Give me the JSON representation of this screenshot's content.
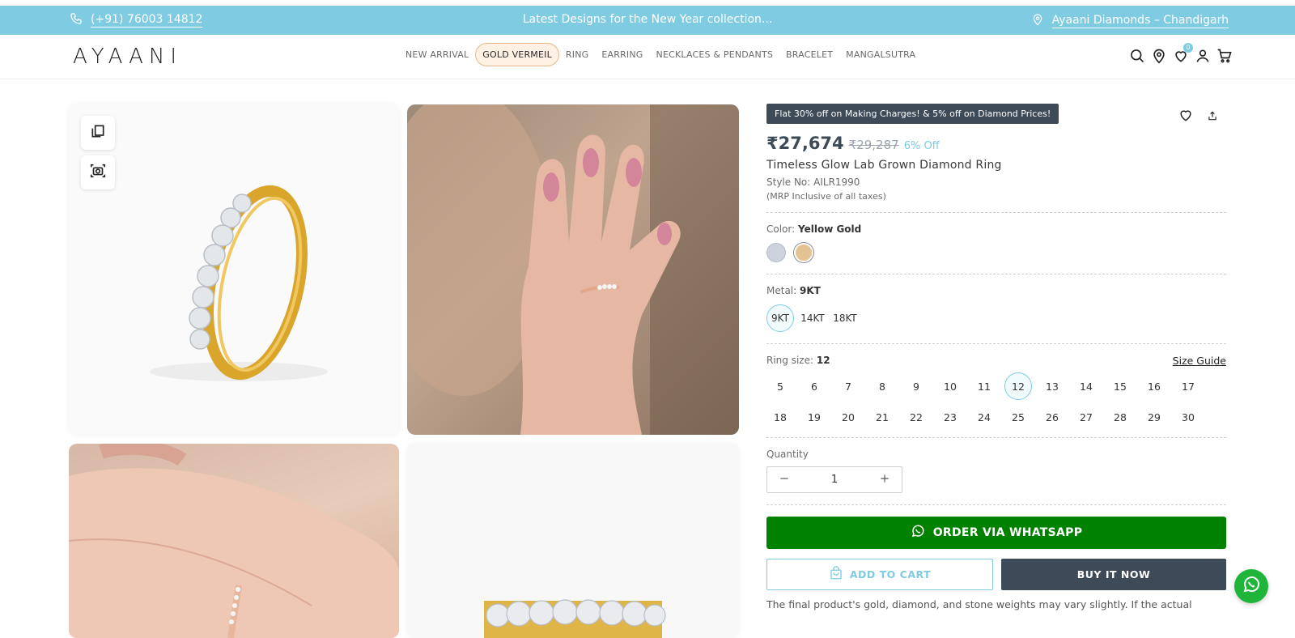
{
  "announcement": {
    "phone": "(+91) 76003 14812",
    "message": "Latest Designs for the New Year collection...",
    "store": "Ayaani Diamonds – Chandigarh"
  },
  "header": {
    "logo": "AYAANI",
    "nav": [
      "NEW ARRIVAL",
      "GOLD VERMEIL",
      "RING",
      "EARRING",
      "NECKLACES & PENDANTS",
      "BRACELET",
      "MANGALSUTRA"
    ],
    "active_nav": "GOLD VERMEIL",
    "wishlist_count": "0",
    "icons": [
      "search-icon",
      "store-location-icon",
      "wishlist-heart-icon",
      "account-user-icon",
      "cart-icon"
    ]
  },
  "product": {
    "promo": "Flat 30% off on Making Charges! & 5% off on Diamond Prices!",
    "price": "₹27,674",
    "mrp": "₹29,287",
    "discount": "6% Off",
    "title": "Timeless Glow Lab Grown Diamond Ring",
    "style_no": "Style No: AILR1990",
    "tax_note": "(MRP Inclusive of all taxes)",
    "color_label": "Color:",
    "color_value": "Yellow Gold",
    "colors": [
      {
        "name": "White Gold",
        "hex": "#cdd2dc"
      },
      {
        "name": "Yellow Gold",
        "hex": "#e5c292"
      }
    ],
    "metal_label": "Metal:",
    "metal_value": "9KT",
    "metals": [
      "9KT",
      "14KT",
      "18KT"
    ],
    "size_label": "Ring size:",
    "size_value": "12",
    "size_guide": "Size Guide",
    "sizes": [
      "5",
      "6",
      "7",
      "8",
      "9",
      "10",
      "11",
      "12",
      "13",
      "14",
      "15",
      "16",
      "17",
      "18",
      "19",
      "20",
      "21",
      "22",
      "23",
      "24",
      "25",
      "26",
      "27",
      "28",
      "29",
      "30"
    ],
    "quantity_label": "Quantity",
    "quantity": "1",
    "whatsapp_btn": "ORDER VIA WHATSAPP",
    "add_to_cart": "ADD TO CART",
    "buy_now": "BUY IT NOW",
    "disclaimer": "The final product's gold, diamond, and stone weights may vary slightly. If the actual"
  },
  "colors": {
    "accent": "#7fcbe2",
    "dark": "#3d4a57",
    "whatsapp": "#008100"
  }
}
